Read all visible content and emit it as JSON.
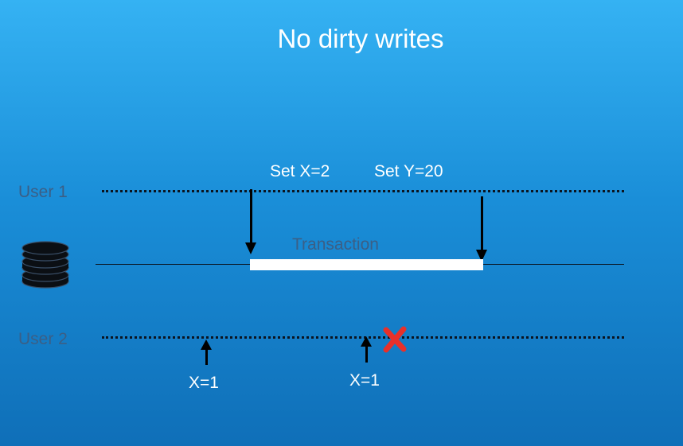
{
  "title": "No dirty writes",
  "user1": {
    "label": "User 1",
    "ops": [
      "Set X=2",
      "Set Y=20"
    ]
  },
  "database": {
    "icon": "database-icon",
    "transaction_label": "Transaction"
  },
  "user2": {
    "label": "User 2",
    "reads": [
      "X=1",
      "X=1"
    ],
    "blocked_icon": "red-x-icon"
  },
  "colors": {
    "background_top": "#35b2f3",
    "background_bottom": "#0f6fb8",
    "label_dark": "#3b5f86",
    "blocked": "#e8302a"
  }
}
